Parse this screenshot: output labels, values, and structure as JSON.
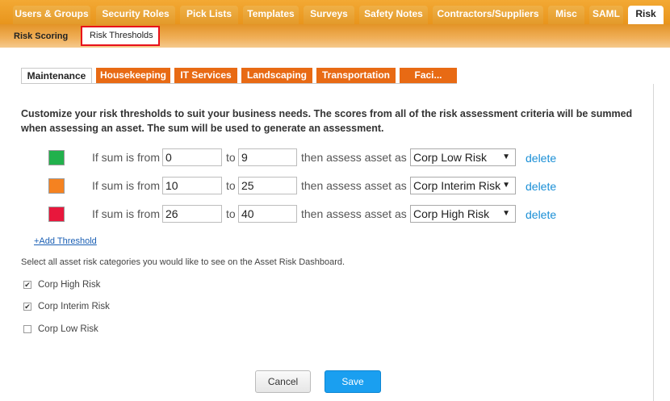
{
  "top_tabs": [
    {
      "label": "Users & Groups",
      "active": false
    },
    {
      "label": "Security Roles",
      "active": false
    },
    {
      "label": "Pick Lists",
      "active": false
    },
    {
      "label": "Templates",
      "active": false
    },
    {
      "label": "Surveys",
      "active": false
    },
    {
      "label": "Safety Notes",
      "active": false
    },
    {
      "label": "Contractors/Suppliers",
      "active": false
    },
    {
      "label": "Misc",
      "active": false
    },
    {
      "label": "SAML",
      "active": false
    },
    {
      "label": "Risk",
      "active": true
    }
  ],
  "sub_tabs": [
    {
      "label": "Risk Scoring",
      "active": false
    },
    {
      "label": "Risk Thresholds",
      "active": true
    }
  ],
  "content_tabs": [
    {
      "label": "Maintenance",
      "active": true
    },
    {
      "label": "Housekeeping",
      "active": false
    },
    {
      "label": "IT Services",
      "active": false
    },
    {
      "label": "Landscaping",
      "active": false
    },
    {
      "label": "Transportation",
      "active": false
    },
    {
      "label": "Faci...",
      "active": false
    }
  ],
  "intro_text": "Customize your risk thresholds to suit your business needs. The scores from all of the risk assessment criteria will be summed when assessing an asset. The sum will be used to generate an assessment.",
  "thresholds": [
    {
      "color": "#22b14c",
      "from_label": "If sum is from",
      "from": "0",
      "to_label": "to",
      "to": "9",
      "assess_label": "then assess asset as",
      "category": "Corp Low Risk",
      "delete_label": "delete"
    },
    {
      "color": "#f58220",
      "from_label": "If sum is from",
      "from": "10",
      "to_label": "to",
      "to": "25",
      "assess_label": "then assess asset as",
      "category": "Corp Interim Risk",
      "delete_label": "delete"
    },
    {
      "color": "#e8173c",
      "from_label": "If sum is from",
      "from": "26",
      "to_label": "to",
      "to": "40",
      "assess_label": "then assess asset as",
      "category": "Corp High Risk",
      "delete_label": "delete"
    }
  ],
  "add_threshold_label": "+Add Threshold",
  "dashboard_info": "Select all asset risk categories you would like to see on the Asset Risk Dashboard.",
  "dashboard_categories": [
    {
      "label": "Corp High Risk",
      "checked": true
    },
    {
      "label": "Corp Interim Risk",
      "checked": true
    },
    {
      "label": "Corp Low Risk",
      "checked": false
    }
  ],
  "buttons": {
    "cancel": "Cancel",
    "save": "Save"
  }
}
